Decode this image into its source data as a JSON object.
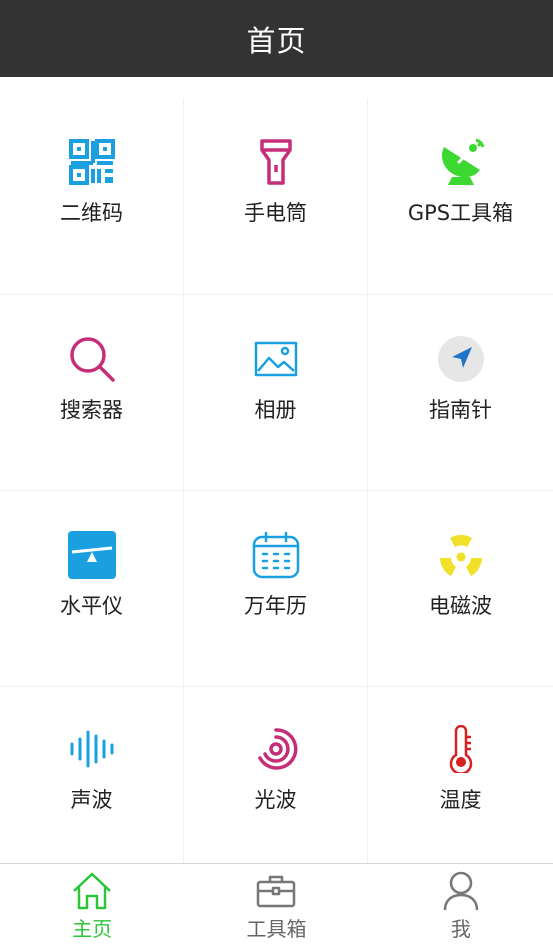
{
  "header": {
    "title": "首页"
  },
  "colors": {
    "header_bg": "#333333",
    "active_tab": "#2bc639",
    "inactive_tab": "#666666",
    "blue": "#1aa0e0",
    "magenta": "#c72e7a",
    "green": "#3bd82f",
    "yellow": "#f1e02a",
    "red": "#d82020"
  },
  "tools": [
    {
      "label": "二维码",
      "icon": "qr-code-icon"
    },
    {
      "label": "手电筒",
      "icon": "flashlight-icon"
    },
    {
      "label": "GPS工具箱",
      "icon": "satellite-dish-icon"
    },
    {
      "label": "搜索器",
      "icon": "search-icon"
    },
    {
      "label": "相册",
      "icon": "photo-album-icon"
    },
    {
      "label": "指南针",
      "icon": "compass-icon"
    },
    {
      "label": "水平仪",
      "icon": "level-icon"
    },
    {
      "label": "万年历",
      "icon": "calendar-icon"
    },
    {
      "label": "电磁波",
      "icon": "radiation-icon"
    },
    {
      "label": "声波",
      "icon": "sound-wave-icon"
    },
    {
      "label": "光波",
      "icon": "light-wave-icon"
    },
    {
      "label": "温度",
      "icon": "thermometer-icon"
    }
  ],
  "bottom_nav": [
    {
      "label": "主页",
      "icon": "home-icon",
      "active": true
    },
    {
      "label": "工具箱",
      "icon": "toolbox-icon",
      "active": false
    },
    {
      "label": "我",
      "icon": "user-icon",
      "active": false
    }
  ]
}
